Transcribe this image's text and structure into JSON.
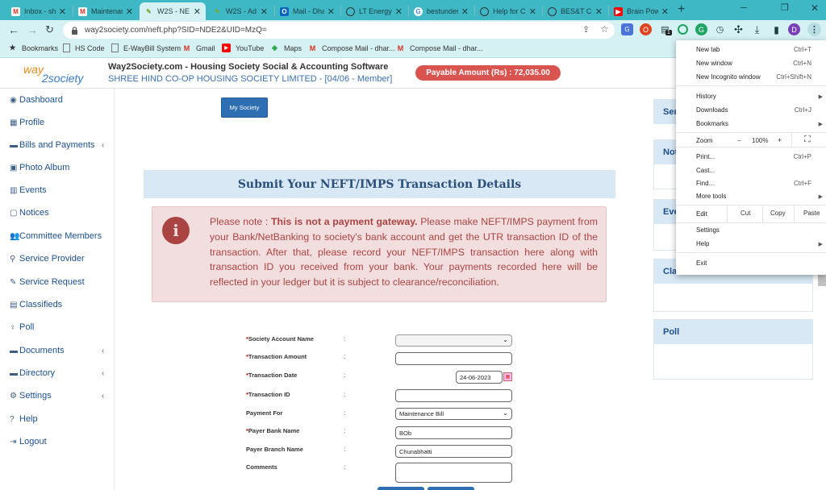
{
  "browser": {
    "tabs": [
      {
        "label": "Inbox - sh",
        "favicon": "gmail-icon"
      },
      {
        "label": "Maintenan",
        "favicon": "gmail-icon"
      },
      {
        "label": "W2S - NE",
        "favicon": "way2society-icon"
      },
      {
        "label": "W2S - Ad",
        "favicon": "way2society-icon"
      },
      {
        "label": "Mail - Dha",
        "favicon": "outlook-icon"
      },
      {
        "label": "LT Energy",
        "favicon": "globe-icon"
      },
      {
        "label": "bestundert",
        "favicon": "google-icon"
      },
      {
        "label": "Help for C",
        "favicon": "globe-icon"
      },
      {
        "label": "BES&T Co",
        "favicon": "globe-icon"
      },
      {
        "label": "Brain Pow",
        "favicon": "youtube-icon"
      }
    ],
    "new_tab_symbol": "+",
    "url": "way2society.com/neft.php?SID=NDE2&UID=MzQ=",
    "profile_initial": "D",
    "extension_badge": "1",
    "bookmarks": [
      {
        "label": "Bookmarks",
        "icon": "star-icon"
      },
      {
        "label": "HS Code",
        "icon": "page-icon"
      },
      {
        "label": "E-WayBill System",
        "icon": "page-icon"
      },
      {
        "label": "Gmail",
        "icon": "gmail-icon"
      },
      {
        "label": "YouTube",
        "icon": "youtube-icon"
      },
      {
        "label": "Maps",
        "icon": "maps-icon"
      },
      {
        "label": "Compose Mail - dhar...",
        "icon": "gmail-icon"
      },
      {
        "label": "Compose Mail - dhar...",
        "icon": "gmail-icon"
      }
    ]
  },
  "site": {
    "logo_text_1": "way",
    "logo_text_2": "2society",
    "title": "Way2Society.com - Housing Society Social & Accounting Software",
    "subtitle": "SHREE HIND CO-OP HOUSING SOCIETY LIMITED - [04/06 - Member]",
    "payable_amount": "Payable Amount (Rs) : 72,035.00"
  },
  "sidebar": {
    "items": [
      {
        "label": "Dashboard",
        "icon": "palette-icon",
        "has_submenu": false
      },
      {
        "label": "Profile",
        "icon": "table-icon",
        "has_submenu": false
      },
      {
        "label": "Bills and Payments",
        "icon": "folder-icon",
        "has_submenu": true
      },
      {
        "label": "Photo Album",
        "icon": "image-icon",
        "has_submenu": false
      },
      {
        "label": "Events",
        "icon": "calendar-icon",
        "has_submenu": false
      },
      {
        "label": "Notices",
        "icon": "notice-icon",
        "has_submenu": false
      },
      {
        "label": "Committee Members",
        "icon": "users-icon",
        "has_submenu": false
      },
      {
        "label": "Service Provider",
        "icon": "search-icon",
        "has_submenu": false
      },
      {
        "label": "Service Request",
        "icon": "edit-icon",
        "has_submenu": false
      },
      {
        "label": "Classifieds",
        "icon": "books-icon",
        "has_submenu": false
      },
      {
        "label": "Poll",
        "icon": "bulb-icon",
        "has_submenu": false
      },
      {
        "label": "Documents",
        "icon": "document-icon",
        "has_submenu": true
      },
      {
        "label": "Directory",
        "icon": "folder-icon",
        "has_submenu": true
      },
      {
        "label": "Settings",
        "icon": "gear-icon",
        "has_submenu": true
      },
      {
        "label": "Help",
        "icon": "question-icon",
        "has_submenu": false
      },
      {
        "label": "Logout",
        "icon": "logout-icon",
        "has_submenu": false
      }
    ]
  },
  "main": {
    "my_society_button": "My Society",
    "heading": "Submit Your NEFT/IMPS Transaction Details",
    "note_prefix": "Please note : ",
    "note_bold": "This is not a payment gateway.",
    "note_text": " Please make NEFT/IMPS payment from your Bank/NetBanking to society's bank account and get the UTR transaction ID of the transaction. After that, please record your NEFT/IMPS transaction here along with transaction ID you received from your bank. Your payments recorded here will be reflected in your ledger but it is subject to clearance/reconciliation.",
    "form": {
      "colon": ":",
      "fields": [
        {
          "label": "Society Account Name",
          "required": true,
          "type": "select",
          "value": ""
        },
        {
          "label": "Transaction Amount",
          "required": true,
          "type": "text",
          "value": ""
        },
        {
          "label": "Transaction Date",
          "required": true,
          "type": "date",
          "value": "24-06-2023"
        },
        {
          "label": "Transaction ID",
          "required": true,
          "type": "text",
          "value": ""
        },
        {
          "label": "Payment For",
          "required": false,
          "type": "select",
          "value": "Maintenance Bill"
        },
        {
          "label": "Payer Bank Name",
          "required": true,
          "type": "text",
          "value": "BOb"
        },
        {
          "label": "Payer Branch Name",
          "required": false,
          "type": "text",
          "value": "Chunabhatti"
        },
        {
          "label": "Comments",
          "required": false,
          "type": "textarea",
          "value": ""
        }
      ]
    }
  },
  "right_panels": [
    {
      "title": "Ser"
    },
    {
      "title": "Not"
    },
    {
      "title": "Eve"
    },
    {
      "title": "Cla"
    },
    {
      "title": "Poll"
    }
  ],
  "chrome_menu": {
    "items": [
      {
        "label": "New tab",
        "shortcut": "Ctrl+T"
      },
      {
        "label": "New window",
        "shortcut": "Ctrl+N"
      },
      {
        "label": "New Incognito window",
        "shortcut": "Ctrl+Shift+N"
      },
      {
        "label": "History",
        "submenu": true
      },
      {
        "label": "Downloads",
        "shortcut": "Ctrl+J"
      },
      {
        "label": "Bookmarks",
        "submenu": true
      },
      {
        "label": "Print...",
        "shortcut": "Ctrl+P"
      },
      {
        "label": "Cast..."
      },
      {
        "label": "Find...",
        "shortcut": "Ctrl+F"
      },
      {
        "label": "More tools",
        "submenu": true
      },
      {
        "label": "Settings"
      },
      {
        "label": "Help",
        "submenu": true
      },
      {
        "label": "Exit"
      }
    ],
    "zoom": {
      "label": "Zoom",
      "minus": "−",
      "value": "100%",
      "plus": "+"
    },
    "edit": {
      "label": "Edit",
      "cut": "Cut",
      "copy": "Copy",
      "paste": "Paste"
    }
  },
  "colors": {
    "tabbar": "#3fb8c5",
    "toolbar": "#d6f1f4",
    "sidebar_text": "#1b4f8c",
    "payable_badge": "#d9534f",
    "heading_band": "#d9e8f5",
    "note_bg": "#f2dede",
    "note_text": "#a94442",
    "button_blue": "#2e6fb3"
  }
}
